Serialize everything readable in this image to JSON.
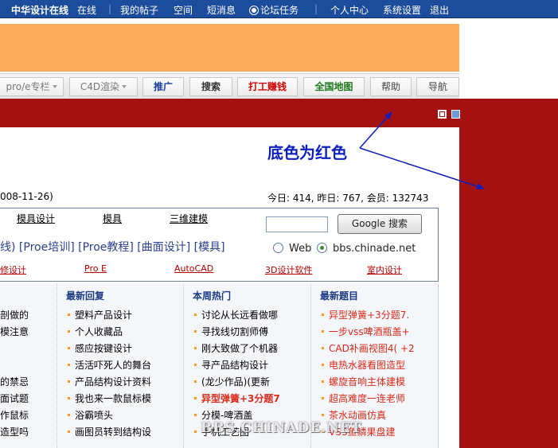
{
  "topnav": {
    "brand": "中华设计在线",
    "links": [
      "在线",
      "我的帖子",
      "空间",
      "短消息",
      "论坛任务",
      "个人中心",
      "系统设置",
      "退出"
    ],
    "separator": "|",
    "bg_color": "#1c4c9c"
  },
  "toolbar": {
    "buttons": [
      "pro/e专栏",
      "C4D渲染",
      "推广",
      "搜索",
      "打工赚钱",
      "全国地图",
      "帮助",
      "导航"
    ]
  },
  "annotation": {
    "text": "底色为红色",
    "color": "#0c1ebd"
  },
  "background": {
    "red": "#a31211",
    "banner": "#ffab5e"
  },
  "info": {
    "date": "008-11-26)",
    "stats": "今日: 414, 昨日: 767, 会员: 132743"
  },
  "search": {
    "row1_links": [
      "模具设计",
      "模具",
      "三维建模"
    ],
    "row2_text": "线) [Proe培训] [Proe教程] [曲面设计] [模具]",
    "row3_links": [
      "修设计",
      "Pro E",
      "AutoCAD",
      "3D设计软件",
      "室内设计"
    ],
    "button_label": "Google 搜索",
    "input_value": "",
    "options": [
      "Web",
      "bbs.chinade.net"
    ],
    "selected": "bbs.chinade.net"
  },
  "columns": {
    "col0": {
      "items": [
        "剖做的",
        "模注意",
        "",
        "",
        "的禁忌",
        "面试题",
        "作鼠标",
        "造型吗"
      ]
    },
    "col1": {
      "title": "最新回复",
      "items": [
        "塑料产品设计",
        "个人收藏品",
        "感应按键设计",
        "活活吓死人的舞台",
        "产品结构设计资料",
        "我也来一款鼠标模",
        "浴霸喷头",
        "画图员转到结构设"
      ]
    },
    "col2": {
      "title": "本周热门",
      "items": [
        "讨论从长远看做哪",
        "寻找线切割师傅",
        "刚大致做了个机器",
        "寻产品结构设计",
        "(龙少作品)(更新",
        "异型弹簧+3分题7",
        "分模-啤酒盖",
        "手机工艺图"
      ]
    },
    "col3": {
      "title": "最新题目",
      "items": [
        "异型弹簧+3分题7.",
        "一步vss啤酒瓶盖+",
        "CAD补画视图4( +2",
        "电热水器看图造型",
        "螺旋音响主体建模",
        "超高难度一连老师",
        "茶水动画仿真",
        "VSS鱼鳞果盘建"
      ]
    }
  },
  "watermark": "BBS.CHINADE.NET"
}
